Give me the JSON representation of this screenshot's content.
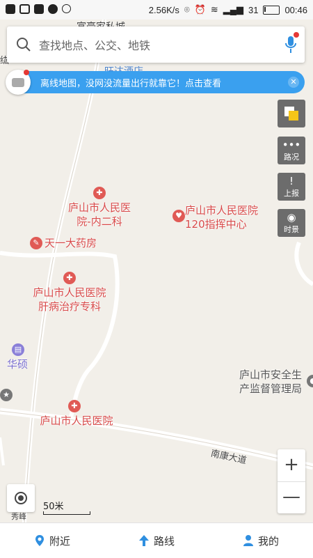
{
  "status_bar": {
    "speed": "2.56K/s",
    "signal": "31",
    "time": "00:46",
    "icons": [
      "notification-icon",
      "image-icon",
      "k-app-icon",
      "weather-icon",
      "smile-icon",
      "location-icon",
      "alarm-icon",
      "wifi-icon",
      "signal-icon",
      "battery-icon"
    ]
  },
  "search": {
    "placeholder": "查找地点、公交、地铁",
    "icon": "search-icon",
    "voice_icon": "microphone-icon"
  },
  "banner": {
    "text": "离线地图，没网没流量出行就靠它！点击查看",
    "icon": "message-icon",
    "close_icon": "close-icon"
  },
  "side_tools": {
    "layers_icon": "layers-icon",
    "traffic": "路况",
    "report": "上报",
    "time_view": "时景"
  },
  "map_labels": {
    "top_partial_1": "富豪家私城",
    "top_partial_2": "旺达酒店",
    "left_partial": "纮",
    "poi_1_line1": "庐山市人民医",
    "poi_1_line2": "院-内二科",
    "poi_2_line1": "庐山市人民医院",
    "poi_2_line2": "120指挥中心",
    "poi_3": "天一大药房",
    "poi_4_line1": "庐山市人民医院",
    "poi_4_line2": "肝病治疗专科",
    "poi_5": "华硕",
    "poi_6_line1": "庐山市安全生",
    "poi_6_line2": "产监督管理局",
    "poi_7": "庐山市人民医院",
    "road_1": "南康大道",
    "road_bottom_partial": "秀峰"
  },
  "map_controls": {
    "zoom_in": "+",
    "zoom_out": "—",
    "scale": "50米",
    "locate_icon": "locate-icon"
  },
  "bottom_nav": {
    "nearby": "附近",
    "route": "路线",
    "mine": "我的"
  },
  "colors": {
    "accent_blue": "#3aa0ef",
    "poi_red": "#d84a4a",
    "map_bg": "#f2efe9"
  }
}
